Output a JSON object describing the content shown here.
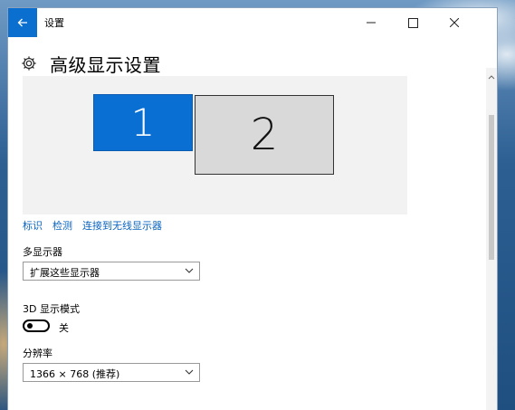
{
  "window": {
    "title": "设置",
    "back_icon": "back-arrow-icon"
  },
  "page": {
    "title": "高级显示设置",
    "icon": "gear-icon"
  },
  "displays": {
    "monitor_1_label": "1",
    "monitor_2_label": "2",
    "selected": "1",
    "selected_color": "#0a6fd3"
  },
  "links": {
    "identify": "标识",
    "detect": "检测",
    "connect_wireless": "连接到无线显示器"
  },
  "multi_display": {
    "label": "多显示器",
    "value": "扩展这些显示器"
  },
  "mode_3d": {
    "label": "3D 显示模式",
    "state_label": "关",
    "on": false
  },
  "resolution": {
    "label": "分辨率",
    "value": "1366 × 768 (推荐)"
  },
  "accent_color": "#0b6fd0"
}
